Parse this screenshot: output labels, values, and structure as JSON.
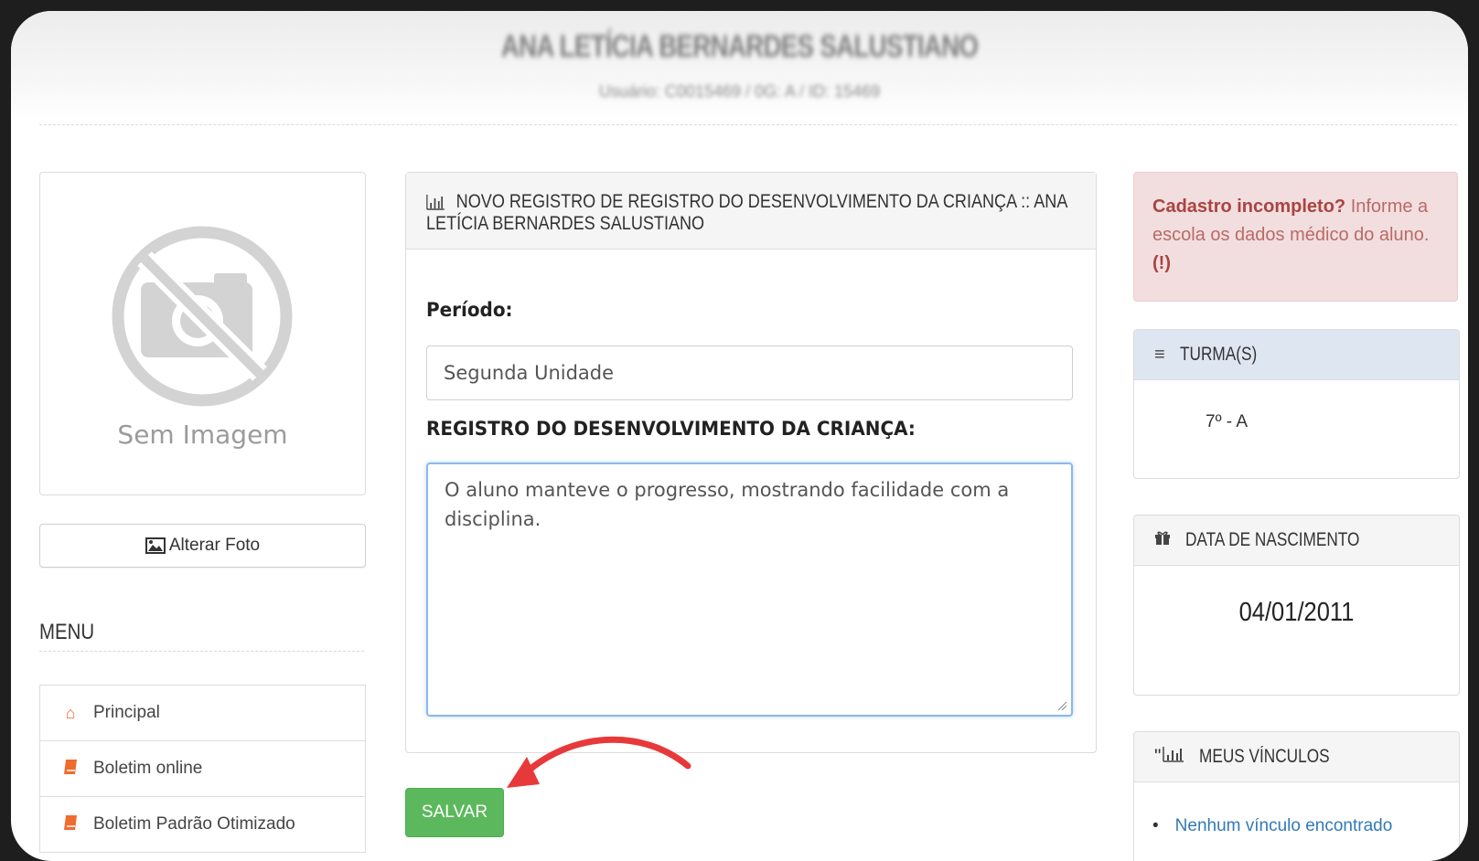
{
  "header": {
    "student_name": "ANA LETÍCIA BERNARDES SALUSTIANO",
    "user_info": "Usuário: C0015469 / 0G: A / ID: 15469"
  },
  "profile": {
    "no_image_caption": "Sem Imagem",
    "change_photo_label": "Alterar Foto"
  },
  "menu": {
    "title": "MENU",
    "items": [
      {
        "label": "Principal",
        "icon": "home-icon"
      },
      {
        "label": "Boletim online",
        "icon": "book-icon"
      },
      {
        "label": "Boletim Padrão Otimizado",
        "icon": "book-icon"
      }
    ]
  },
  "form": {
    "panel_title": "NOVO REGISTRO DE REGISTRO DO DESENVOLVIMENTO DA CRIANÇA :: ANA LETÍCIA BERNARDES SALUSTIANO",
    "periodo_label": "Período:",
    "periodo_value": "Segunda Unidade",
    "registro_label": "REGISTRO DO DESENVOLVIMENTO DA CRIANÇA:",
    "registro_value": "O aluno manteve o progresso, mostrando facilidade com a disciplina.",
    "save_label": "SALVAR"
  },
  "alert": {
    "strong": "Cadastro incompleto?",
    "text": " Informe a escola os dados médico do aluno. ",
    "mark": "(!)"
  },
  "turmas": {
    "title": "TURMA(s)",
    "value": "7º - A"
  },
  "nascimento": {
    "title": "DATA DE NASCIMENTO",
    "value": "04/01/2011"
  },
  "vinculos": {
    "title": "MEUS VÍNCULOS",
    "prefix": "\"",
    "empty_message": "Nenhum vínculo encontrado"
  },
  "colors": {
    "success": "#5cb85c",
    "danger_bg": "#f2dede",
    "annotation_arrow": "#e8393a",
    "menu_icon": "#ef6c2f"
  }
}
